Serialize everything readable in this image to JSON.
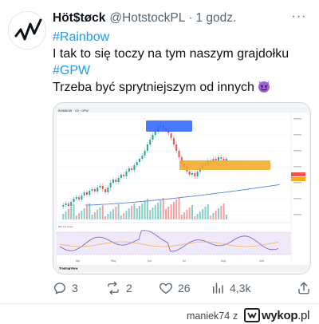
{
  "tweet": {
    "author_name": "Höt$tøck",
    "handle": "@HotstockPL",
    "separator": "·",
    "time": "1 godz.",
    "more_label": "···",
    "lines": {
      "hashtag1": "#Rainbow",
      "text1": "I tak to się toczy na tym naszym grajdołku",
      "hashtag2": "#GPW",
      "text2": "Trzeba być sprytniejszym od innych"
    },
    "emoji": "smiling-devil-emoji",
    "stats": {
      "replies": "3",
      "reposts": "2",
      "likes": "26",
      "views": "4,3k"
    }
  },
  "chart_data": {
    "type": "candlestick",
    "header": "RAINBOW · 1D · GPW",
    "x_labels": [
      "Apr",
      "May",
      "Jun",
      "Jul",
      "Aug",
      "Sep"
    ],
    "annotations": [
      "Blue note (unreadable)",
      "Orange note (unreadable)"
    ],
    "footer": "TradingView"
  },
  "site_footer": {
    "author": "maniek74",
    "z": "z",
    "logo_main": "wykop",
    "logo_tld": ".pl"
  },
  "colors": {
    "link": "#1d9bf0",
    "text": "#0f1419",
    "muted": "#536471",
    "up": "#26a69a",
    "down": "#ef5350",
    "annotation_blue": "#2962ff",
    "annotation_orange": "#f5a623"
  },
  "icons": [
    "reply-icon",
    "repost-icon",
    "like-icon",
    "views-icon",
    "share-icon",
    "more-icon"
  ]
}
